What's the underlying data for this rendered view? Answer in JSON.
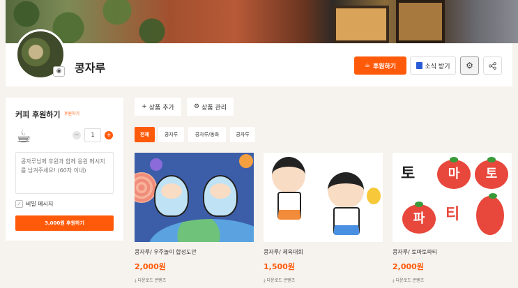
{
  "profile": {
    "name": "콩자루"
  },
  "header_buttons": {
    "support": "후원하기",
    "news": "소식 받기"
  },
  "sidebar": {
    "title": "커피 후원하기",
    "badge": "후원하기",
    "quantity": "1",
    "message_placeholder": "콩자루님께 후원과 함께 응원 메시지를 남겨주세요! (60자 이내)",
    "secret_label": "비밀 메시지",
    "pay_button": "3,000원 후원하기"
  },
  "actions": {
    "add_product": "상품 추가",
    "manage_product": "상품 관리"
  },
  "tabs": [
    "전체",
    "콩자루",
    "콩자루/동화",
    "콩자루"
  ],
  "products": [
    {
      "title": "콩자루/ 우주놀이 합성도안",
      "price": "2,000원",
      "download": "다운로드 콘텐츠"
    },
    {
      "title": "콩자루/ 체육대회",
      "price": "1,500원",
      "download": "다운로드 콘텐츠"
    },
    {
      "title": "콩자루/ 토마토파티",
      "price": "2,000원",
      "download": "다운로드 콘텐츠"
    }
  ],
  "product3_art": {
    "letters": [
      "토",
      "마",
      "토",
      "파",
      "티"
    ]
  },
  "colors": {
    "accent": "#ff5a0a",
    "background": "#f6f2ee"
  }
}
